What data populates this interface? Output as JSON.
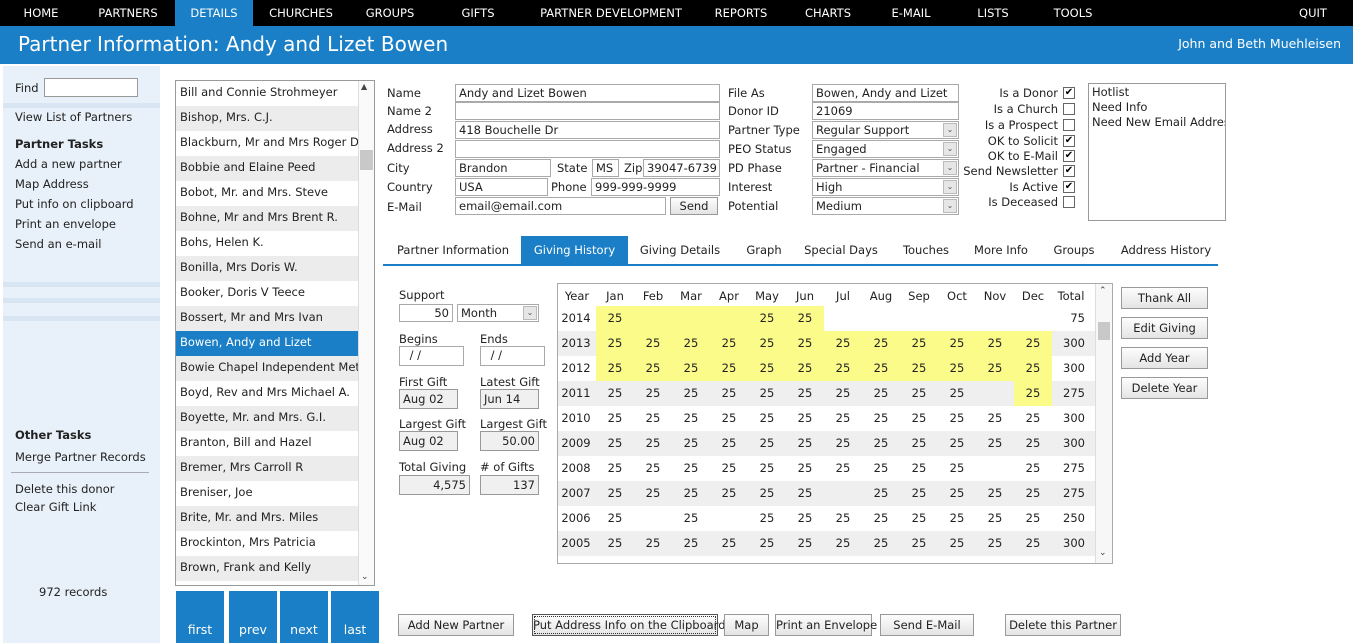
{
  "nav": {
    "items": [
      "HOME",
      "PARTNERS",
      "DETAILS",
      "CHURCHES",
      "GROUPS",
      "GIFTS",
      "PARTNER DEVELOPMENT",
      "REPORTS",
      "CHARTS",
      "E-MAIL",
      "LISTS",
      "TOOLS"
    ],
    "quit": "QUIT"
  },
  "header": {
    "title": "Partner Information: Andy and Lizet Bowen",
    "user": "John and Beth Muehleisen"
  },
  "sidebar": {
    "find_label": "Find",
    "view_list": "View List of Partners",
    "tasks_heading": "Partner Tasks",
    "tasks": [
      "Add a new partner",
      "Map Address",
      "Put info on clipboard",
      "Print an envelope",
      "Send an e-mail"
    ],
    "other_heading": "Other Tasks",
    "merge": "Merge Partner Records",
    "delete_donor": "Delete this donor",
    "clear_gift": "Clear Gift Link",
    "records": "972 records"
  },
  "partner_list": [
    "Bill and Connie Strohmeyer",
    "Bishop, Mrs. C.J.",
    "Blackburn, Mr and Mrs Roger D",
    "Bobbie and Elaine Peed",
    "Bobot, Mr. and Mrs. Steve",
    "Bohne, Mr and Mrs Brent R.",
    "Bohs, Helen K.",
    "Bonilla, Mrs Doris W.",
    "Booker, Doris V Teece",
    "Bossert, Mr and Mrs Ivan",
    "Bowen, Andy and Lizet",
    "Bowie Chapel Independent Met",
    "Boyd, Rev and Mrs Michael A.",
    "Boyette, Mr. and Mrs. G.I.",
    "Branton, Bill and Hazel",
    "Bremer, Mrs Carroll R",
    "Breniser, Joe",
    "Brite, Mr. and Mrs. Miles",
    "Brockinton, Mrs Patricia",
    "Brown, Frank and Kelly"
  ],
  "pager": [
    "first",
    "prev",
    "next",
    "last"
  ],
  "form": {
    "labels": {
      "name": "Name",
      "name2": "Name 2",
      "address": "Address",
      "address2": "Address 2",
      "city": "City",
      "state": "State",
      "zip": "Zip",
      "country": "Country",
      "phone": "Phone",
      "email": "E-Mail",
      "file_as": "File As",
      "donor_id": "Donor ID",
      "partner_type": "Partner Type",
      "peo_status": "PEO Status",
      "pd_phase": "PD Phase",
      "interest": "Interest",
      "potential": "Potential"
    },
    "values": {
      "name": "Andy and Lizet Bowen",
      "name2": "",
      "address": "418 Bouchelle Dr",
      "address2": "",
      "city": "Brandon",
      "state": "MS",
      "zip": "39047-6739",
      "country": "USA",
      "phone": "999-999-9999",
      "email": "email@email.com",
      "file_as": "Bowen, Andy and Lizet",
      "donor_id": "21069",
      "partner_type": "Regular Support",
      "peo_status": "Engaged",
      "pd_phase": "Partner - Financial",
      "interest": "High",
      "potential": "Medium"
    },
    "send_button": "Send"
  },
  "flags": [
    {
      "label": "Is a Donor",
      "checked": true
    },
    {
      "label": "Is a Church",
      "checked": false
    },
    {
      "label": "Is a Prospect",
      "checked": false
    },
    {
      "label": "OK to Solicit",
      "checked": true
    },
    {
      "label": "OK to E-Mail",
      "checked": true
    },
    {
      "label": "Send Newsletter",
      "checked": true
    },
    {
      "label": "Is Active",
      "checked": true
    },
    {
      "label": "Is Deceased",
      "checked": false
    }
  ],
  "tags": [
    "Hotlist",
    "Need Info",
    "Need New Email Address"
  ],
  "tabs": [
    "Partner Information",
    "Giving History",
    "Giving Details",
    "Graph",
    "Special Days",
    "Touches",
    "More Info",
    "Groups",
    "Address History"
  ],
  "giving": {
    "support_label": "Support",
    "support_amount": "50",
    "support_freq": "Month",
    "begins_label": "Begins",
    "begins": " / /",
    "ends_label": "Ends",
    "ends": " / /",
    "first_gift_label": "First Gift",
    "first_gift": "Aug 02",
    "latest_gift_label": "Latest Gift",
    "latest_gift": "Jun 14",
    "largest_gift_label": "Largest Gift",
    "largest_gift_date": "Aug 02",
    "largest_amount_label": "Largest Gift",
    "largest_amount": "50.00",
    "total_label": "Total Giving",
    "total": "4,575",
    "count_label": "# of Gifts",
    "count": "137"
  },
  "grid": {
    "headers": [
      "Year",
      "Jan",
      "Feb",
      "Mar",
      "Apr",
      "May",
      "Jun",
      "Jul",
      "Aug",
      "Sep",
      "Oct",
      "Nov",
      "Dec",
      "Total"
    ],
    "rows": [
      {
        "year": "2014",
        "months": [
          "25",
          "",
          "",
          "",
          "25",
          "25",
          "",
          "",
          "",
          "",
          "",
          ""
        ],
        "total": "75",
        "hl": [
          0,
          4,
          5
        ],
        "hl_blank": [
          1,
          2,
          3
        ]
      },
      {
        "year": "2013",
        "months": [
          "25",
          "25",
          "25",
          "25",
          "25",
          "25",
          "25",
          "25",
          "25",
          "25",
          "25",
          "25"
        ],
        "total": "300",
        "hl": [
          0,
          1,
          2,
          3,
          4,
          5,
          6,
          7,
          8,
          9,
          10,
          11
        ],
        "hl_blank": []
      },
      {
        "year": "2012",
        "months": [
          "25",
          "25",
          "25",
          "25",
          "25",
          "25",
          "25",
          "25",
          "25",
          "25",
          "25",
          "25"
        ],
        "total": "300",
        "hl": [
          0,
          1,
          2,
          3,
          4,
          5,
          6,
          7,
          8,
          9,
          10,
          11
        ],
        "hl_blank": []
      },
      {
        "year": "2011",
        "months": [
          "25",
          "25",
          "25",
          "25",
          "25",
          "25",
          "25",
          "25",
          "25",
          "25",
          "",
          "25"
        ],
        "total": "275",
        "hl": [
          11
        ],
        "hl_blank": []
      },
      {
        "year": "2010",
        "months": [
          "25",
          "25",
          "25",
          "25",
          "25",
          "25",
          "25",
          "25",
          "25",
          "25",
          "25",
          "25"
        ],
        "total": "300",
        "hl": [],
        "hl_blank": []
      },
      {
        "year": "2009",
        "months": [
          "25",
          "25",
          "25",
          "25",
          "25",
          "25",
          "25",
          "25",
          "25",
          "25",
          "25",
          "25"
        ],
        "total": "300",
        "hl": [],
        "hl_blank": []
      },
      {
        "year": "2008",
        "months": [
          "25",
          "25",
          "25",
          "25",
          "25",
          "25",
          "25",
          "25",
          "25",
          "25",
          "",
          "25"
        ],
        "total": "275",
        "hl": [],
        "hl_blank": []
      },
      {
        "year": "2007",
        "months": [
          "25",
          "25",
          "25",
          "25",
          "25",
          "25",
          "",
          "25",
          "25",
          "25",
          "25",
          "25"
        ],
        "total": "275",
        "hl": [],
        "hl_blank": []
      },
      {
        "year": "2006",
        "months": [
          "25",
          "",
          "25",
          "",
          "25",
          "25",
          "25",
          "25",
          "25",
          "25",
          "25",
          "25"
        ],
        "total": "250",
        "hl": [],
        "hl_blank": []
      },
      {
        "year": "2005",
        "months": [
          "25",
          "25",
          "25",
          "25",
          "25",
          "25",
          "25",
          "25",
          "25",
          "25",
          "25",
          "25"
        ],
        "total": "300",
        "hl": [],
        "hl_blank": []
      }
    ]
  },
  "side_buttons": [
    "Thank All",
    "Edit Giving",
    "Add Year",
    "Delete Year"
  ],
  "bottom_buttons": [
    "Add New Partner",
    "Put Address Info on the Clipboard",
    "Map",
    "Print an Envelope",
    "Send E-Mail",
    "Delete this Partner"
  ],
  "colors": {
    "accent": "#1a7fc6",
    "highlight": "#fbfb8a"
  }
}
